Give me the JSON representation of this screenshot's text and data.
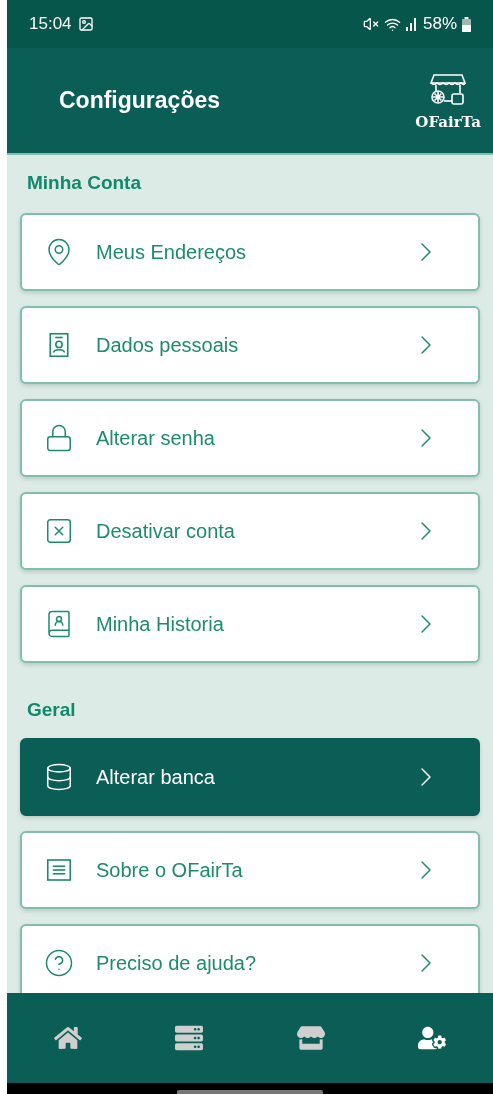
{
  "status_bar": {
    "time": "15:04",
    "battery": "58%"
  },
  "header": {
    "title": "Configurações",
    "logo_text": "OFairTa"
  },
  "sections": [
    {
      "title": "Minha Conta",
      "items": [
        {
          "label": "Meus Endereços",
          "selected": false
        },
        {
          "label": "Dados pessoais",
          "selected": false
        },
        {
          "label": "Alterar senha",
          "selected": false
        },
        {
          "label": "Desativar conta",
          "selected": false
        },
        {
          "label": "Minha Historia",
          "selected": false
        }
      ]
    },
    {
      "title": "Geral",
      "items": [
        {
          "label": "Alterar banca",
          "selected": true
        },
        {
          "label": "Sobre o OFairTa",
          "selected": false
        },
        {
          "label": "Preciso de ajuda?",
          "selected": false
        }
      ]
    }
  ],
  "bottom_nav": [
    {
      "selected": false
    },
    {
      "selected": false
    },
    {
      "selected": false
    },
    {
      "selected": true
    }
  ]
}
